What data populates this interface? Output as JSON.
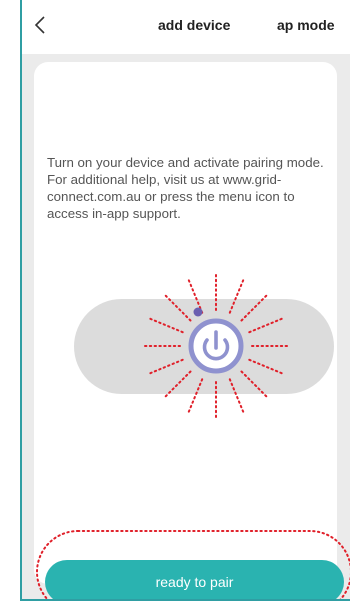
{
  "header": {
    "title": "add device",
    "right_action": "ap mode",
    "back_icon": "chevron-left-icon"
  },
  "instructions": "Turn on your device and activate pairing mode. For additional help, visit us at www.grid-connect.com.au or press the menu icon to access in-app support.",
  "illustration": {
    "icon": "power-icon"
  },
  "pair_button": {
    "label": "ready to pair"
  },
  "colors": {
    "frame": "#2f9ea3",
    "accent": "#2ab3b0",
    "power_ring": "#8f92cf",
    "ray": "#e0202a"
  }
}
